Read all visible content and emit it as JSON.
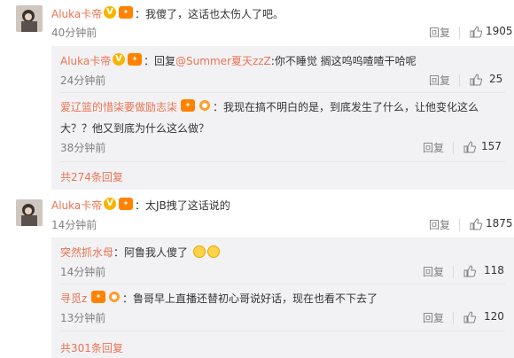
{
  "comments": [
    {
      "author": "Aluka卡帝",
      "text": "我傻了，这话也太伤人了吧。",
      "time": "40分钟前",
      "reply_label": "回复",
      "likes": "1905",
      "replies": [
        {
          "author": "Aluka卡帝",
          "text": "回复@Summer夏天zzZ:你不睡觉 搁这呜呜喳喳干哈呢",
          "reply_prefix": "回复",
          "mention": "@Summer夏天zzZ",
          "rest": ":你不睡觉 搁这呜呜喳喳干哈呢",
          "time": "24分钟前",
          "reply_label": "回复",
          "likes": "25"
        },
        {
          "author": "爱辽篮的惜柒要做励志柒",
          "text_line1": "：我现在搞不明白的是，到底发生了什么，让他变化这么",
          "text_line2": "大？？他又到底为什么这么做？",
          "time": "38分钟前",
          "reply_label": "回复",
          "likes": "157"
        }
      ],
      "more": "共274条回复"
    },
    {
      "author": "Aluka卡帝",
      "text": "：太JB拽了这话说的",
      "time": "14分钟前",
      "reply_label": "回复",
      "likes": "1875",
      "replies": [
        {
          "author": "突然抓水母",
          "text": "：阿鲁我人傻了",
          "time": "14分钟前",
          "reply_label": "回复",
          "likes": "118"
        },
        {
          "author": "寻觅z",
          "text": "：鲁哥早上直播还替初心哥说好话，现在也看不下去了",
          "time": "13分钟前",
          "reply_label": "回复",
          "likes": "120"
        }
      ],
      "more": "共301条回复"
    }
  ],
  "colors": {
    "name": "#eb7350",
    "subbg": "#f2f2f5",
    "text": "#333333",
    "muted": "#808080"
  },
  "icons": [
    "verified-icon",
    "vip-icon",
    "like-icon",
    "crying-emoji-icon"
  ]
}
